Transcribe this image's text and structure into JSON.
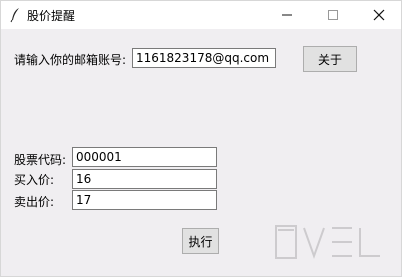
{
  "window": {
    "title": "股价提醒"
  },
  "email": {
    "label": "请输入你的邮箱账号:",
    "value": "1161823178@qq.com"
  },
  "about_button": {
    "label": "关于"
  },
  "stock": {
    "code_label": "股票代码:",
    "code_value": "000001",
    "buy_label": "买入价:",
    "buy_value": "16",
    "sell_label": "卖出价:",
    "sell_value": "17"
  },
  "execute_button": {
    "label": "执行"
  },
  "icons": {
    "app": "feather-icon",
    "minimize": "minimize-icon",
    "maximize": "maximize-icon",
    "close": "close-icon",
    "watermark": "watermark-logo"
  }
}
